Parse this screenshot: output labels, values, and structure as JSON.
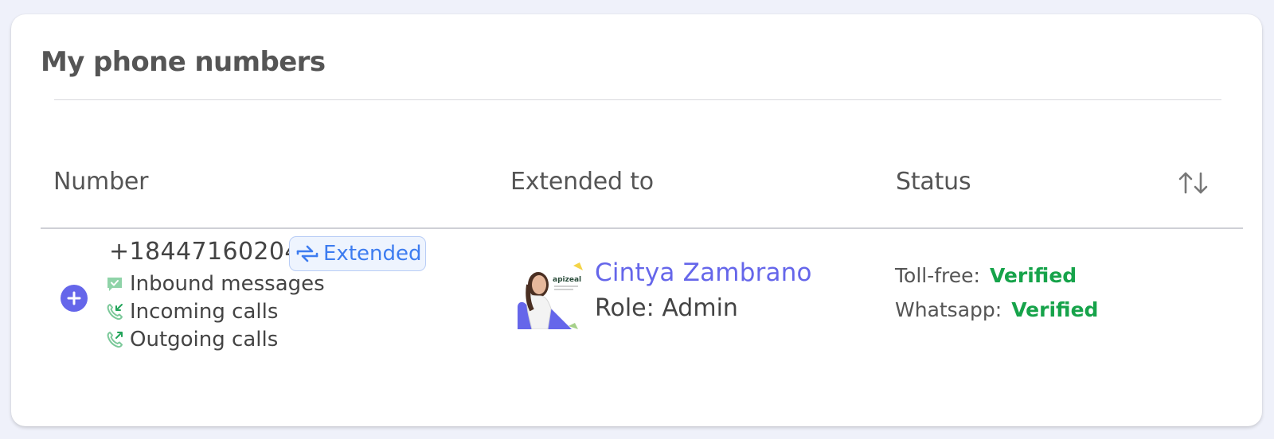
{
  "page_title": "My phone numbers",
  "columns": {
    "number": "Number",
    "extended_to": "Extended to",
    "status": "Status"
  },
  "row": {
    "phone_number": "+18447160204",
    "badge": "Extended",
    "features": [
      {
        "label": "Inbound messages",
        "icon": "message-check-icon"
      },
      {
        "label": "Incoming calls",
        "icon": "incoming-call-icon"
      },
      {
        "label": "Outgoing calls",
        "icon": "outgoing-call-icon"
      }
    ],
    "user": {
      "name": "Cintya Zambrano",
      "role_prefix": "Role:",
      "role": "Admin",
      "avatar_logo_text": "apizeal"
    },
    "status": [
      {
        "label": "Toll-free:",
        "value": "Verified"
      },
      {
        "label": "Whatsapp:",
        "value": "Verified"
      }
    ]
  },
  "colors": {
    "accent": "#6566ea",
    "badge_blue": "#3d7cf0",
    "verified_green": "#16a34a",
    "icon_green": "#7cc99a"
  }
}
